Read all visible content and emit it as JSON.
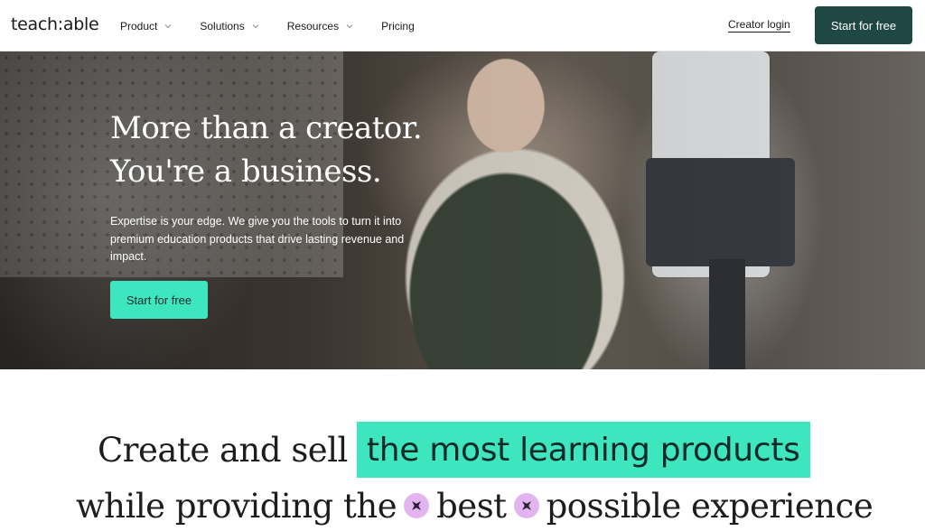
{
  "header": {
    "logo": "teach:able",
    "nav": [
      {
        "label": "Product"
      },
      {
        "label": "Solutions"
      },
      {
        "label": "Resources"
      },
      {
        "label": "Pricing"
      }
    ],
    "creator_login": "Creator login",
    "cta": "Start for free"
  },
  "hero": {
    "title_line1": "More than a creator.",
    "title_line2": "You're a business.",
    "subtitle": "Expertise is your edge. We give you the tools to turn it into premium education products that drive lasting revenue and impact.",
    "cta": "Start for free"
  },
  "headline": {
    "line1_prefix": "Create and sell",
    "line1_highlight": "the most learning products",
    "line2_part1": "while providing the",
    "line2_part2": "best",
    "line2_part3": "possible experience"
  },
  "colors": {
    "accent": "#3ee6c0",
    "dark_button": "#1f4743",
    "spark": "#e3b4f0"
  }
}
